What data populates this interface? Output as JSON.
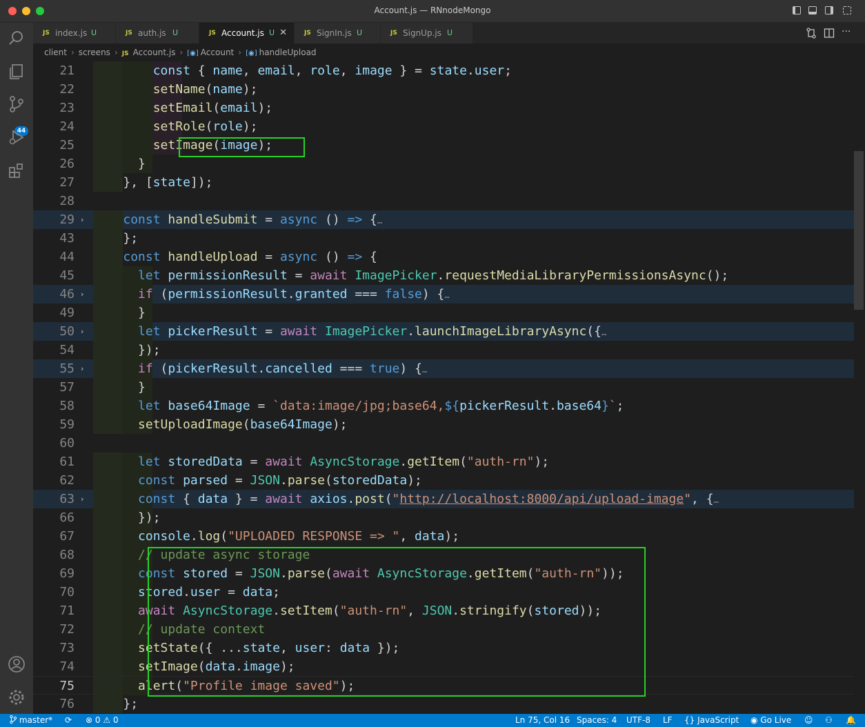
{
  "window": {
    "title": "Account.js — RNnodeMongo"
  },
  "activity_bar": {
    "source_control_badge": "44"
  },
  "tabs": [
    {
      "label": "index.js",
      "status": "U",
      "active": false
    },
    {
      "label": "auth.js",
      "status": "U",
      "active": false
    },
    {
      "label": "Account.js",
      "status": "U",
      "active": true
    },
    {
      "label": "SignIn.js",
      "status": "U",
      "active": false
    },
    {
      "label": "SignUp.js",
      "status": "U",
      "active": false
    }
  ],
  "file_icon_label": "JS",
  "breadcrumb": {
    "parts": [
      "client",
      "screens",
      "Account.js",
      "Account",
      "handleUpload"
    ]
  },
  "lines": [
    {
      "n": "21",
      "tokens": [
        [
          "var",
          "const"
        ],
        [
          "p",
          " { "
        ],
        [
          "var",
          "name"
        ],
        [
          "p",
          ", "
        ],
        [
          "var",
          "email"
        ],
        [
          "p",
          ", "
        ],
        [
          "var",
          "role"
        ],
        [
          "p",
          ", "
        ],
        [
          "var",
          "image"
        ],
        [
          "p",
          " } = "
        ],
        [
          "var",
          "state"
        ],
        [
          "p",
          "."
        ],
        [
          "var",
          "user"
        ],
        [
          "p",
          ";"
        ]
      ]
    },
    {
      "n": "22",
      "tokens": [
        [
          "fn",
          "setName"
        ],
        [
          "p",
          "("
        ],
        [
          "var",
          "name"
        ],
        [
          "p",
          ");"
        ]
      ]
    },
    {
      "n": "23",
      "tokens": [
        [
          "fn",
          "setEmail"
        ],
        [
          "p",
          "("
        ],
        [
          "var",
          "email"
        ],
        [
          "p",
          ");"
        ]
      ]
    },
    {
      "n": "24",
      "tokens": [
        [
          "fn",
          "setRole"
        ],
        [
          "p",
          "("
        ],
        [
          "var",
          "role"
        ],
        [
          "p",
          ");"
        ]
      ]
    },
    {
      "n": "25",
      "tokens": [
        [
          "fn",
          "setImage"
        ],
        [
          "p",
          "("
        ],
        [
          "var",
          "image"
        ],
        [
          "p",
          ");"
        ]
      ]
    },
    {
      "n": "26",
      "tokens": [
        [
          "p",
          "}"
        ]
      ]
    },
    {
      "n": "27",
      "tokens": [
        [
          "p",
          "}, ["
        ],
        [
          "var",
          "state"
        ],
        [
          "p",
          "]);"
        ]
      ]
    },
    {
      "n": "28",
      "tokens": []
    },
    {
      "n": "29",
      "tokens": [
        [
          "kw",
          "const"
        ],
        [
          "p",
          " "
        ],
        [
          "fn",
          "handleSubmit"
        ],
        [
          "p",
          " = "
        ],
        [
          "kw",
          "async"
        ],
        [
          "p",
          " () "
        ],
        [
          "kw",
          "=>"
        ],
        [
          "p",
          " {"
        ]
      ],
      "folded": true
    },
    {
      "n": "43",
      "tokens": [
        [
          "p",
          "};"
        ]
      ]
    },
    {
      "n": "44",
      "tokens": [
        [
          "kw",
          "const"
        ],
        [
          "p",
          " "
        ],
        [
          "fn",
          "handleUpload"
        ],
        [
          "p",
          " = "
        ],
        [
          "kw",
          "async"
        ],
        [
          "p",
          " () "
        ],
        [
          "kw",
          "=>"
        ],
        [
          "p",
          " {"
        ]
      ]
    },
    {
      "n": "45",
      "tokens": [
        [
          "kw",
          "let"
        ],
        [
          "p",
          " "
        ],
        [
          "var",
          "permissionResult"
        ],
        [
          "p",
          " = "
        ],
        [
          "ctl",
          "await"
        ],
        [
          "p",
          " "
        ],
        [
          "cls",
          "ImagePicker"
        ],
        [
          "p",
          "."
        ],
        [
          "fn",
          "requestMediaLibraryPermissionsAsync"
        ],
        [
          "p",
          "();"
        ]
      ]
    },
    {
      "n": "46",
      "tokens": [
        [
          "ctl",
          "if"
        ],
        [
          "p",
          " ("
        ],
        [
          "var",
          "permissionResult"
        ],
        [
          "p",
          "."
        ],
        [
          "var",
          "granted"
        ],
        [
          "p",
          " === "
        ],
        [
          "kw",
          "false"
        ],
        [
          "p",
          ") {"
        ]
      ],
      "folded": true
    },
    {
      "n": "49",
      "tokens": [
        [
          "p",
          "}"
        ]
      ]
    },
    {
      "n": "50",
      "tokens": [
        [
          "kw",
          "let"
        ],
        [
          "p",
          " "
        ],
        [
          "var",
          "pickerResult"
        ],
        [
          "p",
          " = "
        ],
        [
          "ctl",
          "await"
        ],
        [
          "p",
          " "
        ],
        [
          "cls",
          "ImagePicker"
        ],
        [
          "p",
          "."
        ],
        [
          "fn",
          "launchImageLibraryAsync"
        ],
        [
          "p",
          "({"
        ]
      ],
      "folded": true
    },
    {
      "n": "54",
      "tokens": [
        [
          "p",
          "});"
        ]
      ]
    },
    {
      "n": "55",
      "tokens": [
        [
          "ctl",
          "if"
        ],
        [
          "p",
          " ("
        ],
        [
          "var",
          "pickerResult"
        ],
        [
          "p",
          "."
        ],
        [
          "var",
          "cancelled"
        ],
        [
          "p",
          " === "
        ],
        [
          "kw",
          "true"
        ],
        [
          "p",
          ") {"
        ]
      ],
      "folded": true
    },
    {
      "n": "57",
      "tokens": [
        [
          "p",
          "}"
        ]
      ]
    },
    {
      "n": "58",
      "tokens": [
        [
          "kw",
          "let"
        ],
        [
          "p",
          " "
        ],
        [
          "var",
          "base64Image"
        ],
        [
          "p",
          " = "
        ],
        [
          "str",
          "`data:image/jpg;base64,"
        ],
        [
          "kw",
          "${"
        ],
        [
          "var",
          "pickerResult"
        ],
        [
          "p",
          "."
        ],
        [
          "var",
          "base64"
        ],
        [
          "kw",
          "}"
        ],
        [
          "str",
          "`"
        ],
        [
          "p",
          ";"
        ]
      ]
    },
    {
      "n": "59",
      "tokens": [
        [
          "fn",
          "setUploadImage"
        ],
        [
          "p",
          "("
        ],
        [
          "var",
          "base64Image"
        ],
        [
          "p",
          ");"
        ]
      ]
    },
    {
      "n": "60",
      "tokens": []
    },
    {
      "n": "61",
      "tokens": [
        [
          "kw",
          "let"
        ],
        [
          "p",
          " "
        ],
        [
          "var",
          "storedData"
        ],
        [
          "p",
          " = "
        ],
        [
          "ctl",
          "await"
        ],
        [
          "p",
          " "
        ],
        [
          "cls",
          "AsyncStorage"
        ],
        [
          "p",
          "."
        ],
        [
          "fn",
          "getItem"
        ],
        [
          "p",
          "("
        ],
        [
          "str",
          "\"auth-rn\""
        ],
        [
          "p",
          ");"
        ]
      ]
    },
    {
      "n": "62",
      "tokens": [
        [
          "kw",
          "const"
        ],
        [
          "p",
          " "
        ],
        [
          "var",
          "parsed"
        ],
        [
          "p",
          " = "
        ],
        [
          "cls",
          "JSON"
        ],
        [
          "p",
          "."
        ],
        [
          "fn",
          "parse"
        ],
        [
          "p",
          "("
        ],
        [
          "var",
          "storedData"
        ],
        [
          "p",
          ");"
        ]
      ]
    },
    {
      "n": "63",
      "tokens": [
        [
          "kw",
          "const"
        ],
        [
          "p",
          " { "
        ],
        [
          "var",
          "data"
        ],
        [
          "p",
          " } = "
        ],
        [
          "ctl",
          "await"
        ],
        [
          "p",
          " "
        ],
        [
          "var",
          "axios"
        ],
        [
          "p",
          "."
        ],
        [
          "fn",
          "post"
        ],
        [
          "p",
          "("
        ],
        [
          "str",
          "\""
        ],
        [
          "url",
          "http://localhost:8000/api/upload-image"
        ],
        [
          "str",
          "\""
        ],
        [
          "p",
          ", {"
        ]
      ],
      "folded": true
    },
    {
      "n": "66",
      "tokens": [
        [
          "p",
          "});"
        ]
      ]
    },
    {
      "n": "67",
      "tokens": [
        [
          "var",
          "console"
        ],
        [
          "p",
          "."
        ],
        [
          "fn",
          "log"
        ],
        [
          "p",
          "("
        ],
        [
          "str",
          "\"UPLOADED RESPONSE => \""
        ],
        [
          "p",
          ", "
        ],
        [
          "var",
          "data"
        ],
        [
          "p",
          ");"
        ]
      ]
    },
    {
      "n": "68",
      "tokens": [
        [
          "cm",
          "// update async storage"
        ]
      ]
    },
    {
      "n": "69",
      "tokens": [
        [
          "kw",
          "const"
        ],
        [
          "p",
          " "
        ],
        [
          "var",
          "stored"
        ],
        [
          "p",
          " = "
        ],
        [
          "cls",
          "JSON"
        ],
        [
          "p",
          "."
        ],
        [
          "fn",
          "parse"
        ],
        [
          "p",
          "("
        ],
        [
          "ctl",
          "await"
        ],
        [
          "p",
          " "
        ],
        [
          "cls",
          "AsyncStorage"
        ],
        [
          "p",
          "."
        ],
        [
          "fn",
          "getItem"
        ],
        [
          "p",
          "("
        ],
        [
          "str",
          "\"auth-rn\""
        ],
        [
          "p",
          "));"
        ]
      ]
    },
    {
      "n": "70",
      "tokens": [
        [
          "var",
          "stored"
        ],
        [
          "p",
          "."
        ],
        [
          "var",
          "user"
        ],
        [
          "p",
          " = "
        ],
        [
          "var",
          "data"
        ],
        [
          "p",
          ";"
        ]
      ]
    },
    {
      "n": "71",
      "tokens": [
        [
          "ctl",
          "await"
        ],
        [
          "p",
          " "
        ],
        [
          "cls",
          "AsyncStorage"
        ],
        [
          "p",
          "."
        ],
        [
          "fn",
          "setItem"
        ],
        [
          "p",
          "("
        ],
        [
          "str",
          "\"auth-rn\""
        ],
        [
          "p",
          ", "
        ],
        [
          "cls",
          "JSON"
        ],
        [
          "p",
          "."
        ],
        [
          "fn",
          "stringify"
        ],
        [
          "p",
          "("
        ],
        [
          "var",
          "stored"
        ],
        [
          "p",
          "));"
        ]
      ]
    },
    {
      "n": "72",
      "tokens": [
        [
          "cm",
          "// update context"
        ]
      ]
    },
    {
      "n": "73",
      "tokens": [
        [
          "fn",
          "setState"
        ],
        [
          "p",
          "({ ..."
        ],
        [
          "var",
          "state"
        ],
        [
          "p",
          ", "
        ],
        [
          "var",
          "user"
        ],
        [
          "p",
          ": "
        ],
        [
          "var",
          "data"
        ],
        [
          "p",
          " });"
        ]
      ]
    },
    {
      "n": "74",
      "tokens": [
        [
          "fn",
          "setImage"
        ],
        [
          "p",
          "("
        ],
        [
          "var",
          "data"
        ],
        [
          "p",
          "."
        ],
        [
          "var",
          "image"
        ],
        [
          "p",
          ");"
        ]
      ]
    },
    {
      "n": "75",
      "tokens": [
        [
          "fn",
          "alert"
        ],
        [
          "p",
          "("
        ],
        [
          "str",
          "\"Profile image saved\""
        ],
        [
          "p",
          ");"
        ]
      ],
      "current": true
    },
    {
      "n": "76",
      "tokens": [
        [
          "p",
          "};"
        ]
      ]
    }
  ],
  "status_bar": {
    "branch": "master*",
    "problems_errors": "0",
    "problems_warnings": "0",
    "cursor": "Ln 75, Col 16",
    "spaces": "Spaces: 4",
    "encoding": "UTF-8",
    "eol": "LF",
    "language": "JavaScript",
    "go_live": "Go Live"
  }
}
